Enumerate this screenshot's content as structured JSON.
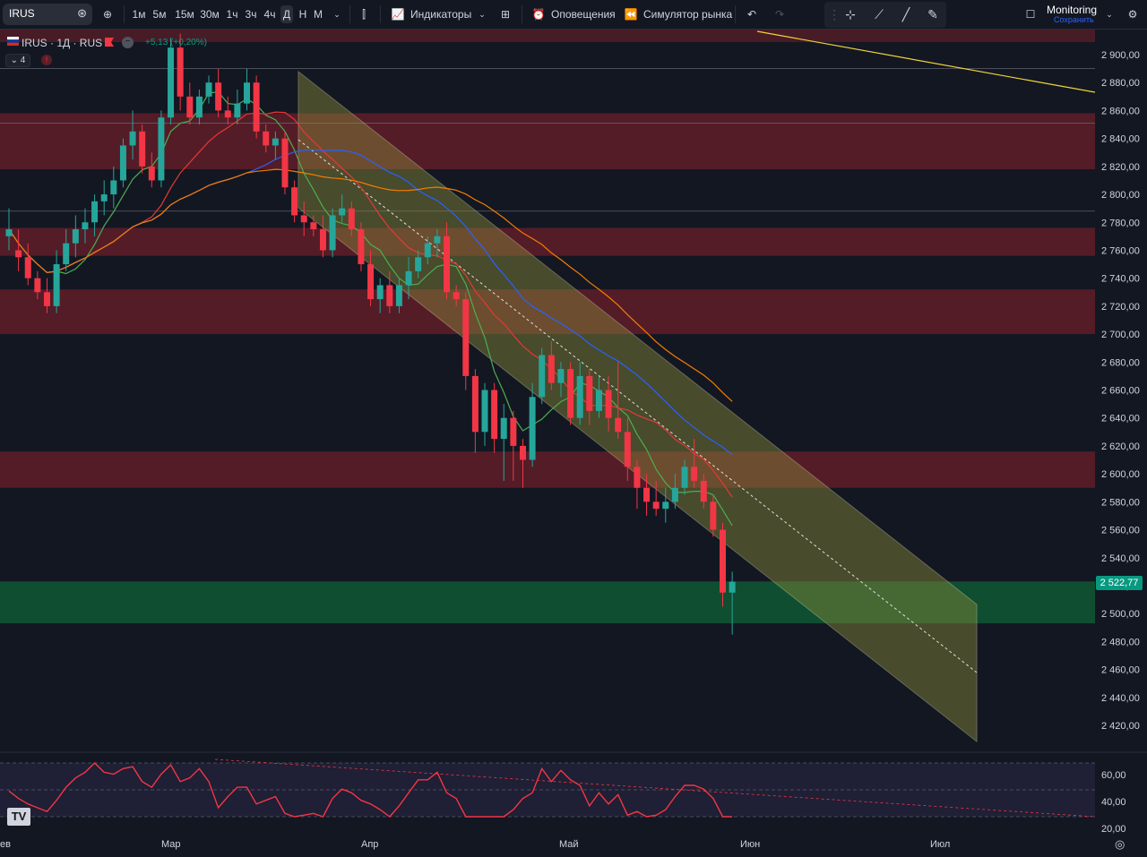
{
  "toolbar": {
    "symbol": "IRUS",
    "timeframes": [
      "1м",
      "5м",
      "15м",
      "30м",
      "1ч",
      "3ч",
      "4ч",
      "Д",
      "Н",
      "М"
    ],
    "active_timeframe": "Д",
    "indicators_label": "Индикаторы",
    "alerts_label": "Оповещения",
    "replay_label": "Симулятор рынка",
    "account_label": "Monitoring",
    "save_label": "Сохранить"
  },
  "legend": {
    "title": "IRUS · 1Д · RUS",
    "change": "+5,13 (+0,20%)",
    "indicators_count": "4",
    "alert_mark": "!"
  },
  "price_axis": {
    "labels": [
      "2 900,00",
      "2 880,00",
      "2 860,00",
      "2 840,00",
      "2 820,00",
      "2 800,00",
      "2 780,00",
      "2 760,00",
      "2 740,00",
      "2 720,00",
      "2 700,00",
      "2 680,00",
      "2 660,00",
      "2 640,00",
      "2 620,00",
      "2 600,00",
      "2 580,00",
      "2 560,00",
      "2 540,00",
      "2 520,00",
      "2 500,00",
      "2 480,00",
      "2 460,00",
      "2 440,00",
      "2 420,00"
    ],
    "current_price": "2 522,77"
  },
  "time_axis": {
    "labels": [
      "ев",
      "Мар",
      "Апр",
      "Май",
      "Июн",
      "Июл"
    ]
  },
  "oscillator_axis": {
    "labels": [
      "60,00",
      "40,00",
      "20,00"
    ]
  },
  "colors": {
    "background": "#131722",
    "up": "#26a69a",
    "down": "#f23645",
    "resistance_zone": "#6b1f2a",
    "support_zone": "#0f5132",
    "channel": "#8a8a3a",
    "ma_green": "#4caf50",
    "ma_red": "#e53935",
    "ma_blue": "#2962ff",
    "ma_orange": "#f57c00",
    "rsi": "#7e57c2"
  },
  "chart_data": {
    "type": "candlestick",
    "candles": [
      [
        2770,
        2790,
        2760,
        2775
      ],
      [
        2760,
        2775,
        2745,
        2755
      ],
      [
        2755,
        2765,
        2735,
        2740
      ],
      [
        2740,
        2745,
        2725,
        2730
      ],
      [
        2730,
        2740,
        2715,
        2720
      ],
      [
        2720,
        2760,
        2715,
        2750
      ],
      [
        2750,
        2775,
        2745,
        2765
      ],
      [
        2765,
        2785,
        2755,
        2775
      ],
      [
        2775,
        2790,
        2765,
        2780
      ],
      [
        2780,
        2800,
        2770,
        2795
      ],
      [
        2795,
        2810,
        2785,
        2800
      ],
      [
        2800,
        2820,
        2790,
        2810
      ],
      [
        2810,
        2840,
        2805,
        2835
      ],
      [
        2835,
        2860,
        2825,
        2845
      ],
      [
        2845,
        2850,
        2815,
        2820
      ],
      [
        2820,
        2830,
        2805,
        2810
      ],
      [
        2810,
        2860,
        2805,
        2855
      ],
      [
        2855,
        2912,
        2850,
        2905
      ],
      [
        2905,
        2915,
        2860,
        2870
      ],
      [
        2870,
        2880,
        2850,
        2855
      ],
      [
        2855,
        2875,
        2850,
        2870
      ],
      [
        2870,
        2885,
        2865,
        2880
      ],
      [
        2880,
        2890,
        2855,
        2860
      ],
      [
        2860,
        2870,
        2850,
        2855
      ],
      [
        2855,
        2875,
        2850,
        2865
      ],
      [
        2865,
        2890,
        2860,
        2880
      ],
      [
        2880,
        2885,
        2840,
        2845
      ],
      [
        2845,
        2850,
        2830,
        2835
      ],
      [
        2835,
        2845,
        2825,
        2840
      ],
      [
        2840,
        2845,
        2800,
        2805
      ],
      [
        2805,
        2810,
        2780,
        2785
      ],
      [
        2785,
        2795,
        2770,
        2780
      ],
      [
        2780,
        2785,
        2770,
        2775
      ],
      [
        2775,
        2785,
        2755,
        2760
      ],
      [
        2760,
        2790,
        2755,
        2785
      ],
      [
        2785,
        2800,
        2780,
        2790
      ],
      [
        2790,
        2795,
        2770,
        2775
      ],
      [
        2775,
        2780,
        2745,
        2750
      ],
      [
        2750,
        2760,
        2720,
        2725
      ],
      [
        2725,
        2740,
        2715,
        2735
      ],
      [
        2735,
        2745,
        2715,
        2720
      ],
      [
        2720,
        2740,
        2715,
        2735
      ],
      [
        2735,
        2755,
        2725,
        2745
      ],
      [
        2745,
        2760,
        2740,
        2755
      ],
      [
        2755,
        2770,
        2750,
        2765
      ],
      [
        2765,
        2775,
        2755,
        2770
      ],
      [
        2770,
        2780,
        2725,
        2730
      ],
      [
        2730,
        2735,
        2720,
        2725
      ],
      [
        2725,
        2730,
        2660,
        2670
      ],
      [
        2670,
        2675,
        2615,
        2630
      ],
      [
        2630,
        2665,
        2620,
        2660
      ],
      [
        2660,
        2665,
        2615,
        2625
      ],
      [
        2625,
        2650,
        2595,
        2640
      ],
      [
        2640,
        2645,
        2595,
        2620
      ],
      [
        2620,
        2625,
        2590,
        2610
      ],
      [
        2610,
        2665,
        2605,
        2655
      ],
      [
        2655,
        2690,
        2650,
        2685
      ],
      [
        2685,
        2695,
        2660,
        2665
      ],
      [
        2665,
        2680,
        2655,
        2675
      ],
      [
        2675,
        2680,
        2635,
        2640
      ],
      [
        2640,
        2680,
        2635,
        2670
      ],
      [
        2670,
        2675,
        2635,
        2645
      ],
      [
        2645,
        2670,
        2640,
        2660
      ],
      [
        2660,
        2670,
        2630,
        2640
      ],
      [
        2640,
        2680,
        2625,
        2630
      ],
      [
        2630,
        2640,
        2595,
        2605
      ],
      [
        2605,
        2610,
        2575,
        2590
      ],
      [
        2590,
        2600,
        2570,
        2580
      ],
      [
        2580,
        2595,
        2570,
        2575
      ],
      [
        2575,
        2590,
        2565,
        2580
      ],
      [
        2580,
        2600,
        2575,
        2590
      ],
      [
        2590,
        2610,
        2585,
        2605
      ],
      [
        2605,
        2625,
        2590,
        2595
      ],
      [
        2595,
        2600,
        2575,
        2580
      ],
      [
        2580,
        2585,
        2555,
        2560
      ],
      [
        2560,
        2565,
        2505,
        2515
      ],
      [
        2515,
        2530,
        2485,
        2522.77
      ]
    ],
    "y_range": [
      2410,
      2920
    ]
  }
}
